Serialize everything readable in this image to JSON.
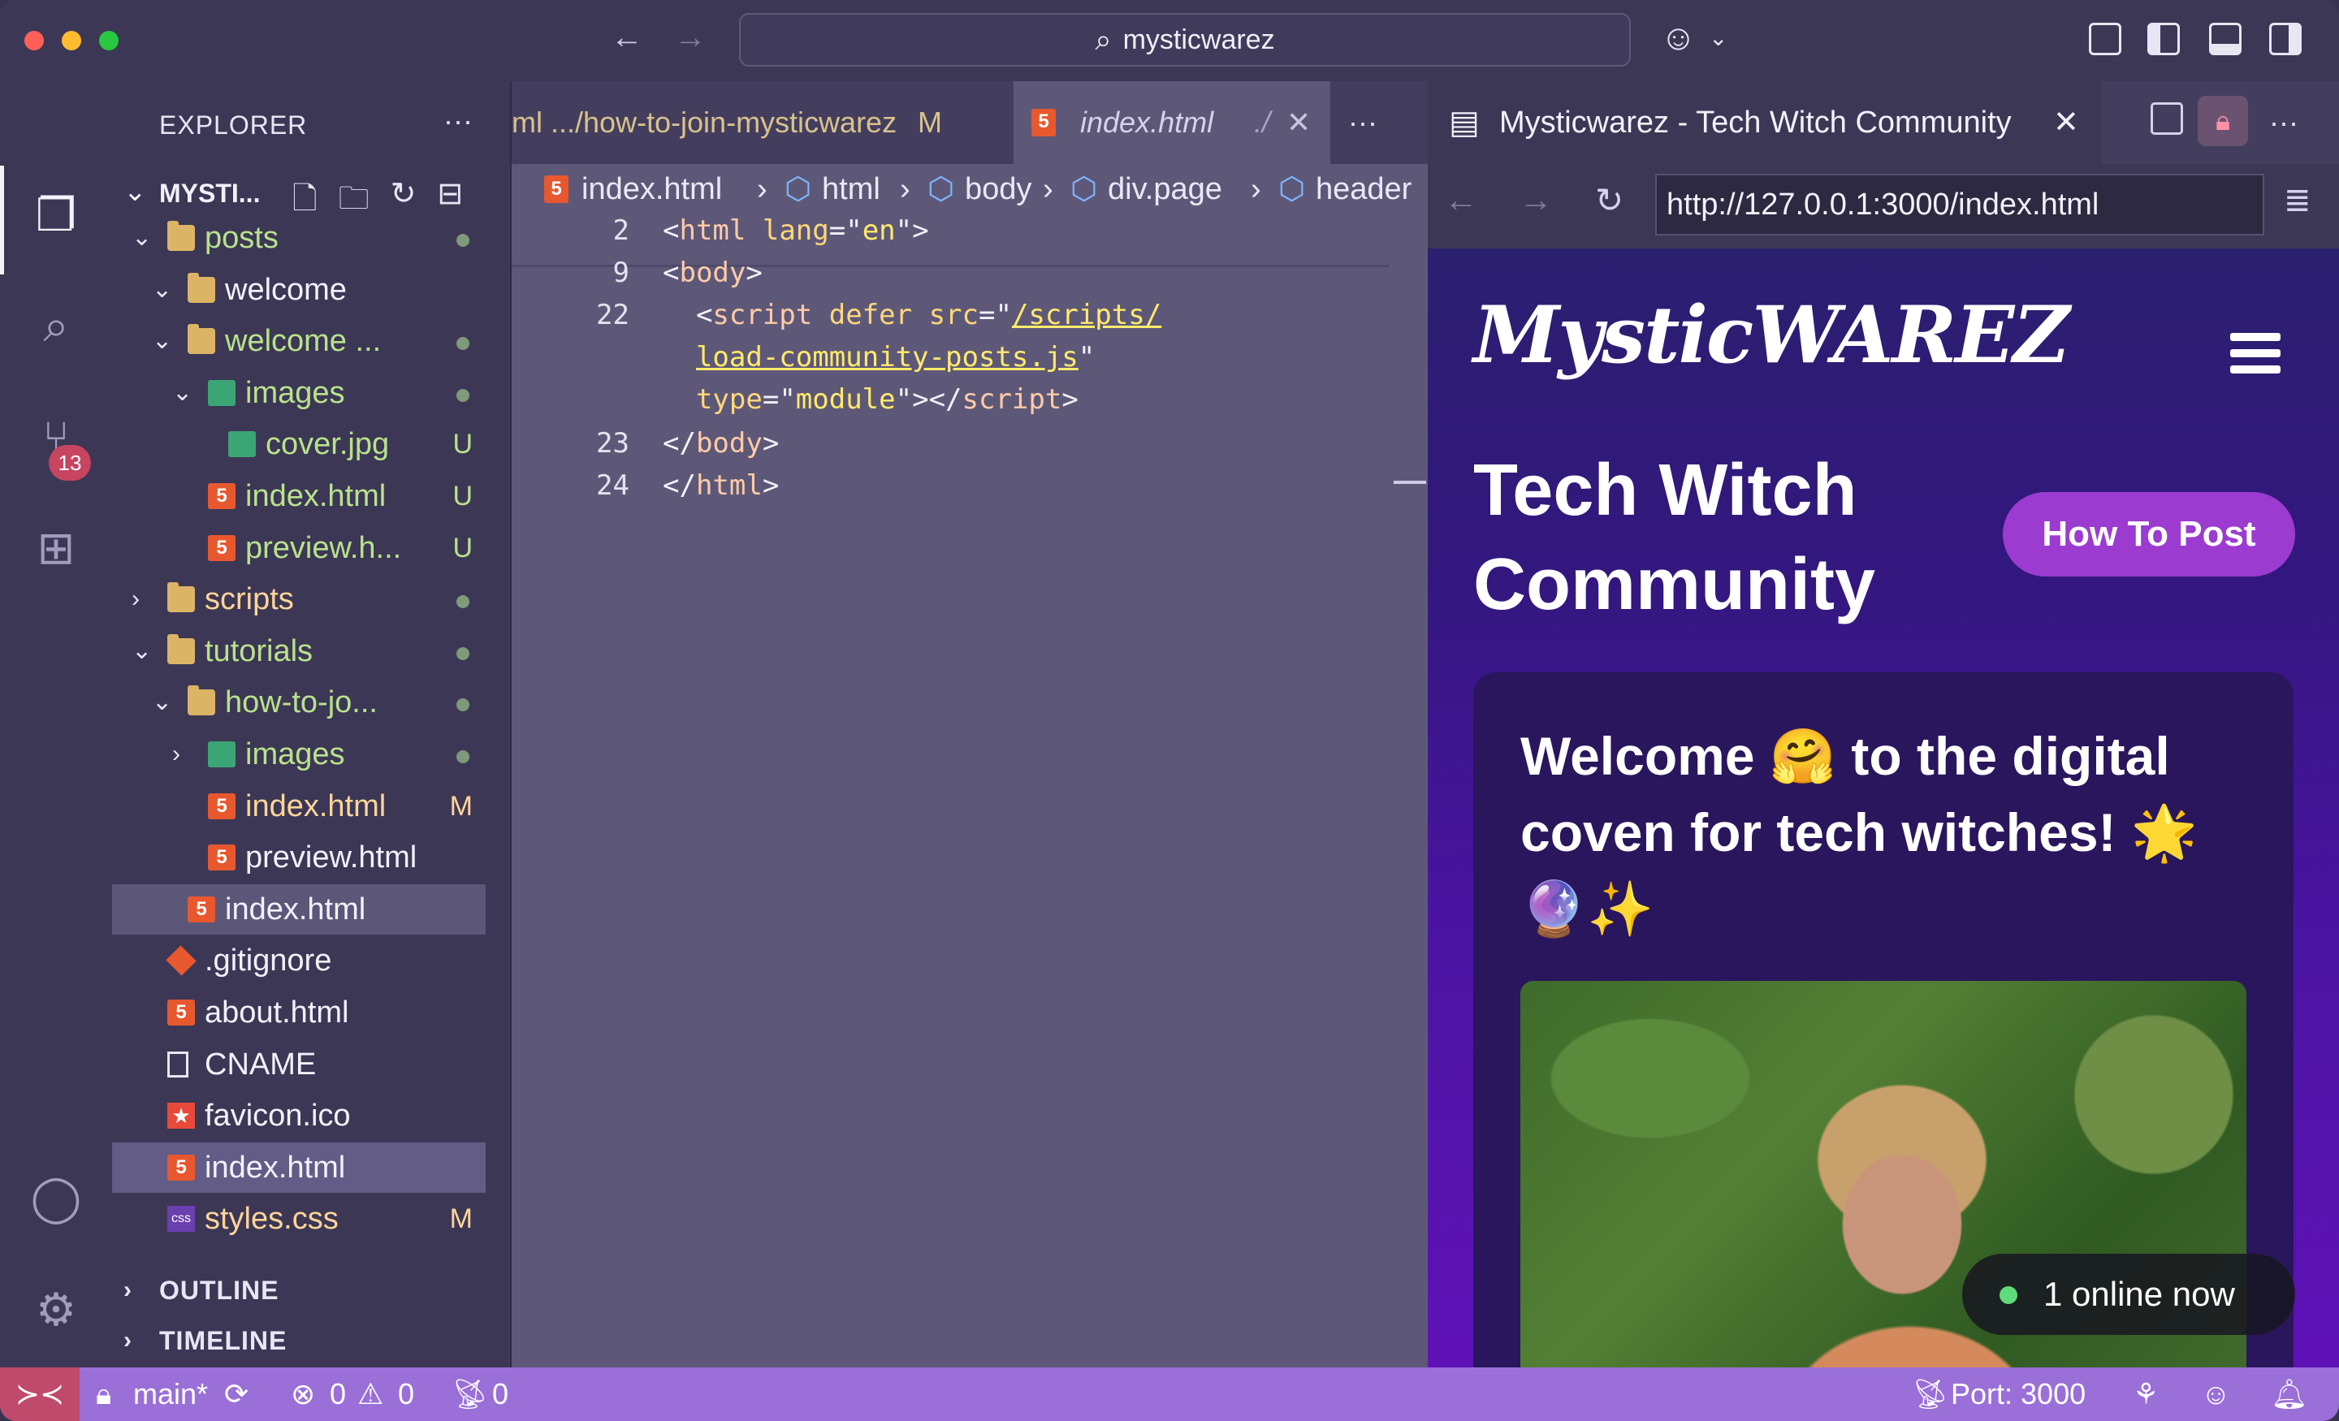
{
  "window": {
    "command_center": "mysticwarez",
    "nav_back": "←",
    "nav_forward": "→"
  },
  "activity_bar": {
    "items": [
      "explorer-icon",
      "search-icon",
      "source-control-icon",
      "extensions-icon"
    ],
    "source_control_badge": "13",
    "bottom": [
      "accounts-icon",
      "settings-icon"
    ]
  },
  "sidebar": {
    "title": "EXPLORER",
    "more": "···",
    "root": "MYSTI...",
    "tree": [
      {
        "label": "posts",
        "kind": "folder",
        "open": true,
        "depth": 0,
        "status": "dot",
        "color": "#b9e28c"
      },
      {
        "label": "welcome",
        "kind": "folder",
        "open": true,
        "depth": 1,
        "status": "",
        "color": "#f2f0fa"
      },
      {
        "label": "welcome ...",
        "kind": "folder",
        "open": true,
        "depth": 1,
        "status": "dot",
        "color": "#b9e28c"
      },
      {
        "label": "images",
        "kind": "imgfolder",
        "open": true,
        "depth": 2,
        "status": "dot",
        "color": "#b9e28c"
      },
      {
        "label": "cover.jpg",
        "kind": "image",
        "depth": 3,
        "status": "U",
        "color": "#b9e28c"
      },
      {
        "label": "index.html",
        "kind": "html",
        "depth": 2,
        "status": "U",
        "color": "#b9e28c"
      },
      {
        "label": "preview.h...",
        "kind": "html",
        "depth": 2,
        "status": "U",
        "color": "#b9e28c"
      },
      {
        "label": "scripts",
        "kind": "folder",
        "open": false,
        "depth": 0,
        "status": "dot",
        "color": "#ffd59a"
      },
      {
        "label": "tutorials",
        "kind": "folder",
        "open": true,
        "depth": 0,
        "status": "dot",
        "color": "#b9e28c"
      },
      {
        "label": "how-to-jo...",
        "kind": "folder",
        "open": true,
        "depth": 1,
        "status": "dot",
        "color": "#b9e28c"
      },
      {
        "label": "images",
        "kind": "imgfolder",
        "open": false,
        "depth": 2,
        "status": "dot",
        "color": "#b9e28c"
      },
      {
        "label": "index.html",
        "kind": "html",
        "depth": 2,
        "status": "M",
        "color": "#ffd59a"
      },
      {
        "label": "preview.html",
        "kind": "html",
        "depth": 2,
        "status": "",
        "color": "#f2f0fa"
      },
      {
        "label": "index.html",
        "kind": "html",
        "depth": 1,
        "status": "",
        "color": "#f2f0fa",
        "selected": "soft"
      },
      {
        "label": ".gitignore",
        "kind": "git",
        "depth": 0,
        "status": "",
        "color": "#f2f0fa"
      },
      {
        "label": "about.html",
        "kind": "html",
        "depth": 0,
        "status": "",
        "color": "#f2f0fa"
      },
      {
        "label": "CNAME",
        "kind": "file",
        "depth": 0,
        "status": "",
        "color": "#f2f0fa"
      },
      {
        "label": "favicon.ico",
        "kind": "star",
        "depth": 0,
        "status": "",
        "color": "#f2f0fa"
      },
      {
        "label": "index.html",
        "kind": "html",
        "depth": 0,
        "status": "",
        "color": "#f2f0fa",
        "selected": "strong"
      },
      {
        "label": "styles.css",
        "kind": "css",
        "depth": 0,
        "status": "M",
        "color": "#ffd59a"
      }
    ],
    "outline": "OUTLINE",
    "timeline": "TIMELINE"
  },
  "editor": {
    "tab1_label": "ml  .../how-to-join-mysticwarez",
    "tab1_status": "M",
    "tab2_label": "index.html",
    "tab2_desc": "./",
    "more": "···",
    "breadcrumb": [
      "index.html",
      "html",
      "body",
      "div.page",
      "header"
    ],
    "lines": [
      {
        "n": "2",
        "html": "&lt;html lang=\"en\"&gt;"
      },
      {
        "n": "9",
        "html": "&lt;body&gt;"
      },
      {
        "n": "22",
        "html": "  &lt;script defer src=\"/scripts/"
      },
      {
        "n": "",
        "html": "  load-community-posts.js\""
      },
      {
        "n": "",
        "html": "  type=\"module\"&gt;&lt;/script&gt;"
      },
      {
        "n": "23",
        "html": "&lt;/body&gt;"
      },
      {
        "n": "24",
        "html": "&lt;/html&gt;"
      }
    ]
  },
  "browser": {
    "tab_title": "Mysticwarez - Tech Witch Community",
    "url": "http://127.0.0.1:3000/index.html",
    "logo": "MysticWAREZ",
    "title": "Tech Witch Community",
    "cta": "How To Post",
    "card_title": "Welcome 🤗 to the digital coven for tech witches! 🌟 🔮✨",
    "online": "1 online now"
  },
  "status_bar": {
    "branch": "main*",
    "errors": "0",
    "warnings": "0",
    "ports_count": "0",
    "port": "Port: 3000"
  },
  "colors": {
    "accent": "#9a6fd8",
    "remote": "#c04a6c",
    "cta": "#9b3bd0"
  }
}
